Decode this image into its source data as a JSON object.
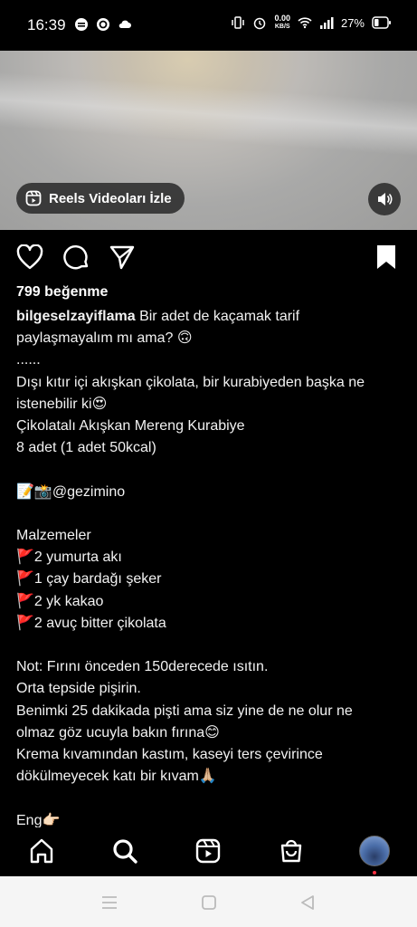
{
  "status_bar": {
    "time": "16:39",
    "net_speed_value": "0.00",
    "net_speed_unit": "KB/S",
    "battery_percent": "27%"
  },
  "video": {
    "reels_button_label": "Reels Videoları İzle"
  },
  "post": {
    "likes": "799 beğenme",
    "username": "bilgeselzayiflama",
    "caption_lines": [
      " Bir adet de kaçamak tarif",
      "paylaşmayalım mı ama? 🙃",
      "......",
      "Dışı kıtır içi akışkan çikolata, bir kurabiyeden başka ne",
      "istenebilir ki😍",
      "Çikolatalı Akışkan Mereng Kurabiye",
      "8 adet (1 adet 50kcal)",
      "",
      "📝📸@gezimino",
      "",
      "Malzemeler",
      "🚩2 yumurta akı",
      "🚩1 çay bardağı şeker",
      "🚩2 yk kakao",
      "🚩2 avuç bitter çikolata",
      "",
      "Not: Fırını önceden 150derecede ısıtın.",
      "Orta tepside pişirin.",
      "Benimki 25 dakikada pişti ama siz yine de ne olur ne",
      "olmaz göz ucuyla bakın fırına😊",
      "Krema kıvamından kastım, kaseyi ters çevirince",
      "dökülmeyecek katı bir kıvam🙏🏼",
      "",
      "Eng👉🏻"
    ]
  },
  "icons": {
    "like": "heart-icon",
    "comment": "comment-icon",
    "share": "send-icon",
    "save": "bookmark-icon",
    "nav": [
      "home-icon",
      "search-icon",
      "reels-icon",
      "shop-icon",
      "profile-avatar"
    ],
    "system": [
      "menu-icon",
      "home-square-icon",
      "back-icon"
    ]
  },
  "colors": {
    "background": "#000000",
    "text": "#ffffff",
    "notification_dot": "#ff3040",
    "system_nav_bg": "#f5f5f5"
  }
}
